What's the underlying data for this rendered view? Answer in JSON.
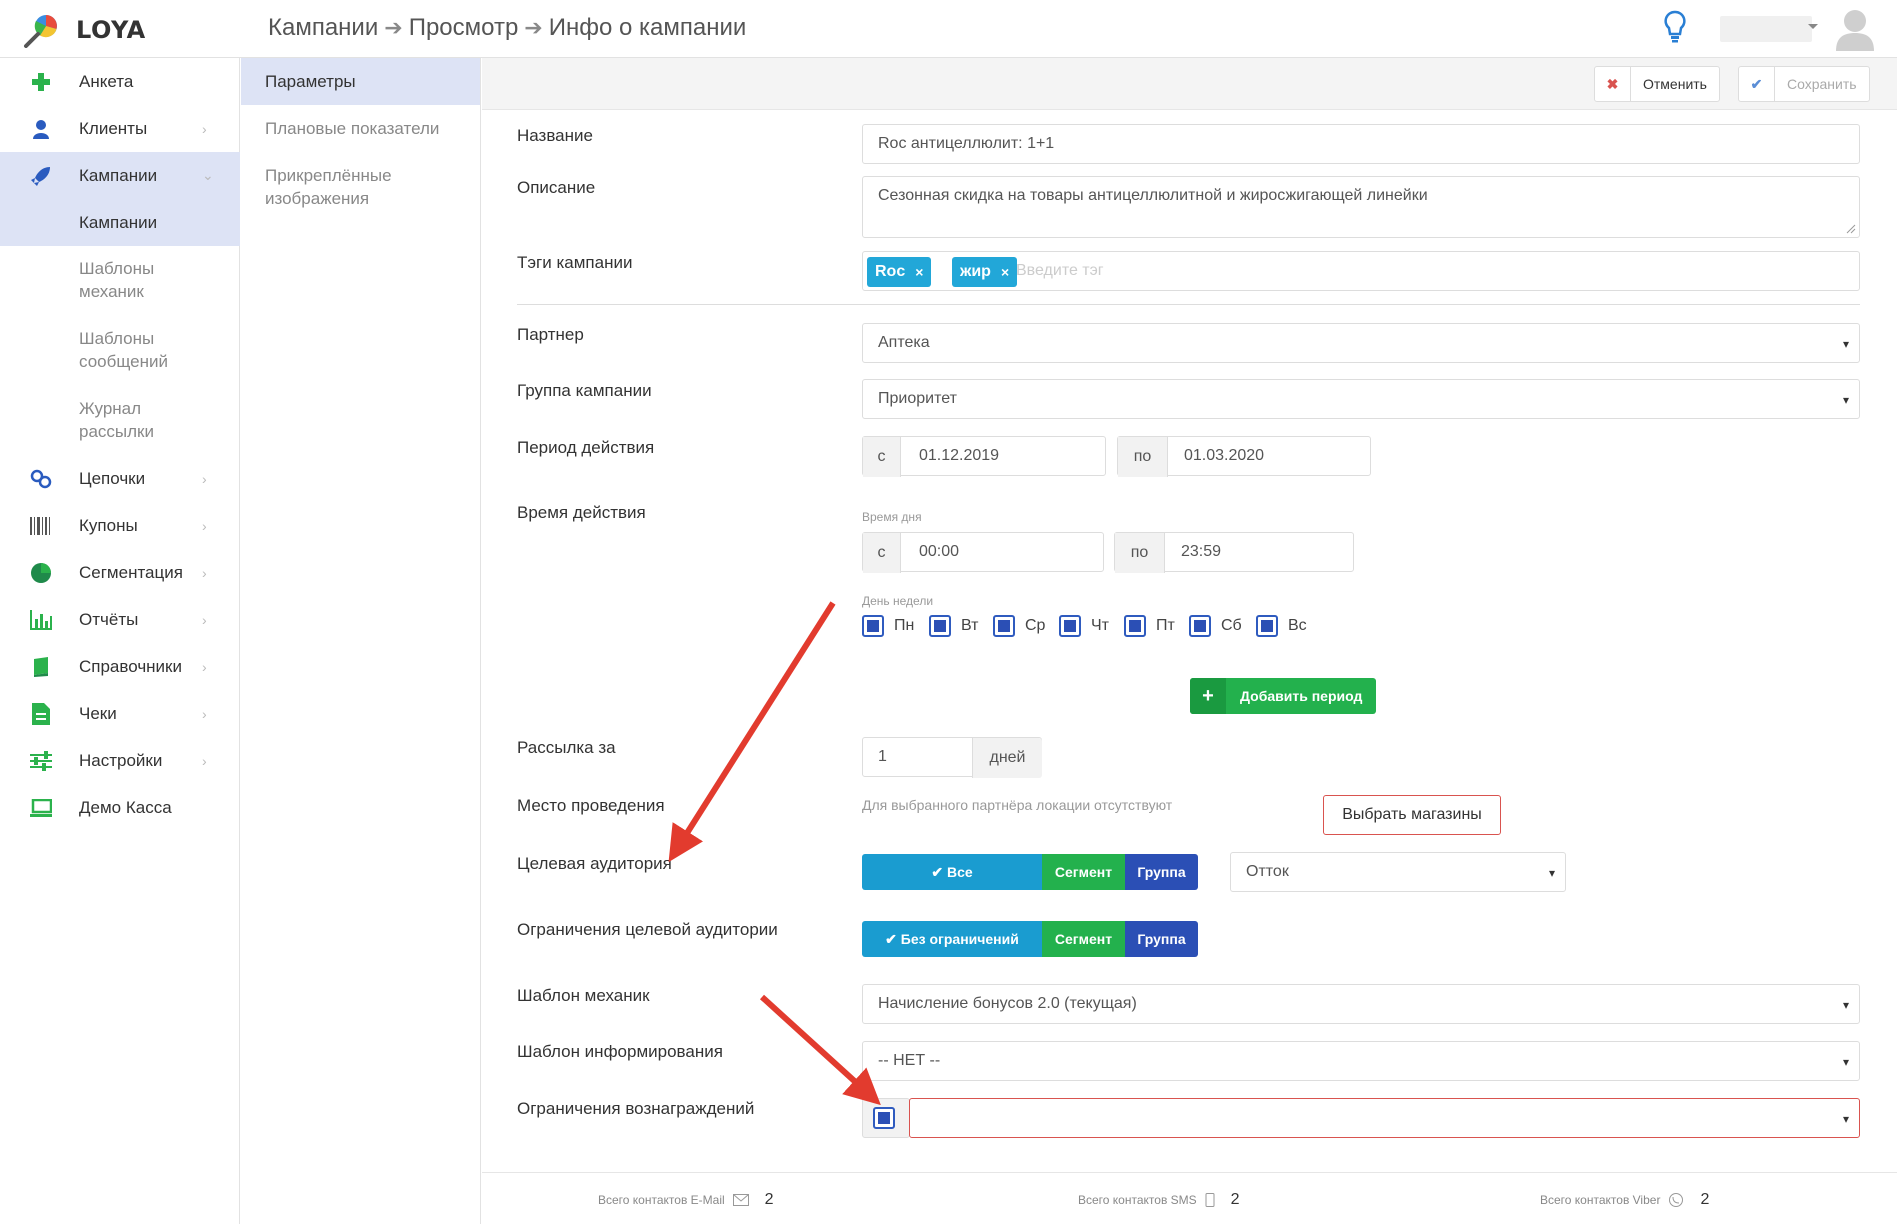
{
  "app": {
    "name": "LOYA"
  },
  "breadcrumbs": [
    "Кампании",
    "Просмотр",
    "Инфо о кампании"
  ],
  "sidebar": {
    "items": [
      {
        "label": "Анкета",
        "icon": "plus-icon"
      },
      {
        "label": "Клиенты",
        "icon": "user-icon"
      },
      {
        "label": "Кампании",
        "icon": "rocket-icon"
      },
      {
        "label": "Цепочки",
        "icon": "link-icon"
      },
      {
        "label": "Купоны",
        "icon": "barcode-icon"
      },
      {
        "label": "Сегментация",
        "icon": "pie-chart-icon"
      },
      {
        "label": "Отчёты",
        "icon": "bar-chart-icon"
      },
      {
        "label": "Справочники",
        "icon": "book-icon"
      },
      {
        "label": "Чеки",
        "icon": "receipt-icon"
      },
      {
        "label": "Настройки",
        "icon": "sliders-icon"
      },
      {
        "label": "Демо Касса",
        "icon": "laptop-icon"
      }
    ],
    "sub_items": [
      "Кампании",
      "Шаблоны механик",
      "Шаблоны сообщений",
      "Журнал рассылки"
    ]
  },
  "subnav": {
    "items": [
      "Параметры",
      "Плановые показатели",
      "Прикреплённые изображения"
    ]
  },
  "toolbar": {
    "cancel_label": "Отменить",
    "save_label": "Сохранить"
  },
  "form": {
    "name": {
      "label": "Название",
      "value": "Roc антицеллюлит: 1+1"
    },
    "description": {
      "label": "Описание",
      "value": "Сезонная скидка на товары антицеллюлитной и жиросжигающей линейки"
    },
    "tags": {
      "label": "Тэги кампании",
      "items": [
        "Roc",
        "жир"
      ],
      "placeholder": "Введите тэг",
      "remove_glyph": "×"
    },
    "partner": {
      "label": "Партнер",
      "value": "Аптека"
    },
    "group": {
      "label": "Группа кампании",
      "value": "Приоритет"
    },
    "period": {
      "label": "Период действия",
      "from_prefix": "с",
      "from": "01.12.2019",
      "to_prefix": "по",
      "to": "01.03.2020"
    },
    "time": {
      "label": "Время действия",
      "day_time_caption": "Время дня",
      "from_prefix": "с",
      "from": "00:00",
      "to_prefix": "по",
      "to": "23:59",
      "weekday_caption": "День недели",
      "days": [
        "Пн",
        "Вт",
        "Ср",
        "Чт",
        "Пт",
        "Сб",
        "Вс"
      ],
      "add_period_label": "Добавить период",
      "add_period_glyph": "+"
    },
    "mailing": {
      "label": "Рассылка за",
      "value": "1",
      "unit": "дней"
    },
    "location": {
      "label": "Место проведения",
      "note": "Для выбранного партнёра локации отсутствуют",
      "choose_label": "Выбрать магазины"
    },
    "audience": {
      "label": "Целевая аудитория",
      "options": [
        "✔ Все",
        "Сегмент",
        "Группа"
      ],
      "selected": "Все",
      "select_value": "Отток"
    },
    "audience_limits": {
      "label": "Ограничения целевой аудитории",
      "options": [
        "✔ Без ограничений",
        "Сегмент",
        "Группа"
      ],
      "selected": "Без ограничений"
    },
    "mechanics_template": {
      "label": "Шаблон механик",
      "value": "Начисление бонусов 2.0 (текущая)"
    },
    "info_template": {
      "label": "Шаблон информирования",
      "value": "-- НЕТ --"
    },
    "reward_limits": {
      "label": "Ограничения вознаграждений",
      "value": ""
    }
  },
  "select_caret": "▾",
  "footer": {
    "stats": [
      {
        "label": "Всего контактов E-Mail",
        "value": "2",
        "icon": "envelope-icon"
      },
      {
        "label": "Всего контактов SMS",
        "value": "2",
        "icon": "phone-icon"
      },
      {
        "label": "Всего контактов Viber",
        "value": "2",
        "icon": "viber-icon"
      }
    ]
  },
  "colors": {
    "accent_blue": "#1a9cd0",
    "green": "#23b14d",
    "dark_blue": "#2b4fb5",
    "red_arrow": "#e23b2e",
    "active_bg": "#dde3f5"
  }
}
